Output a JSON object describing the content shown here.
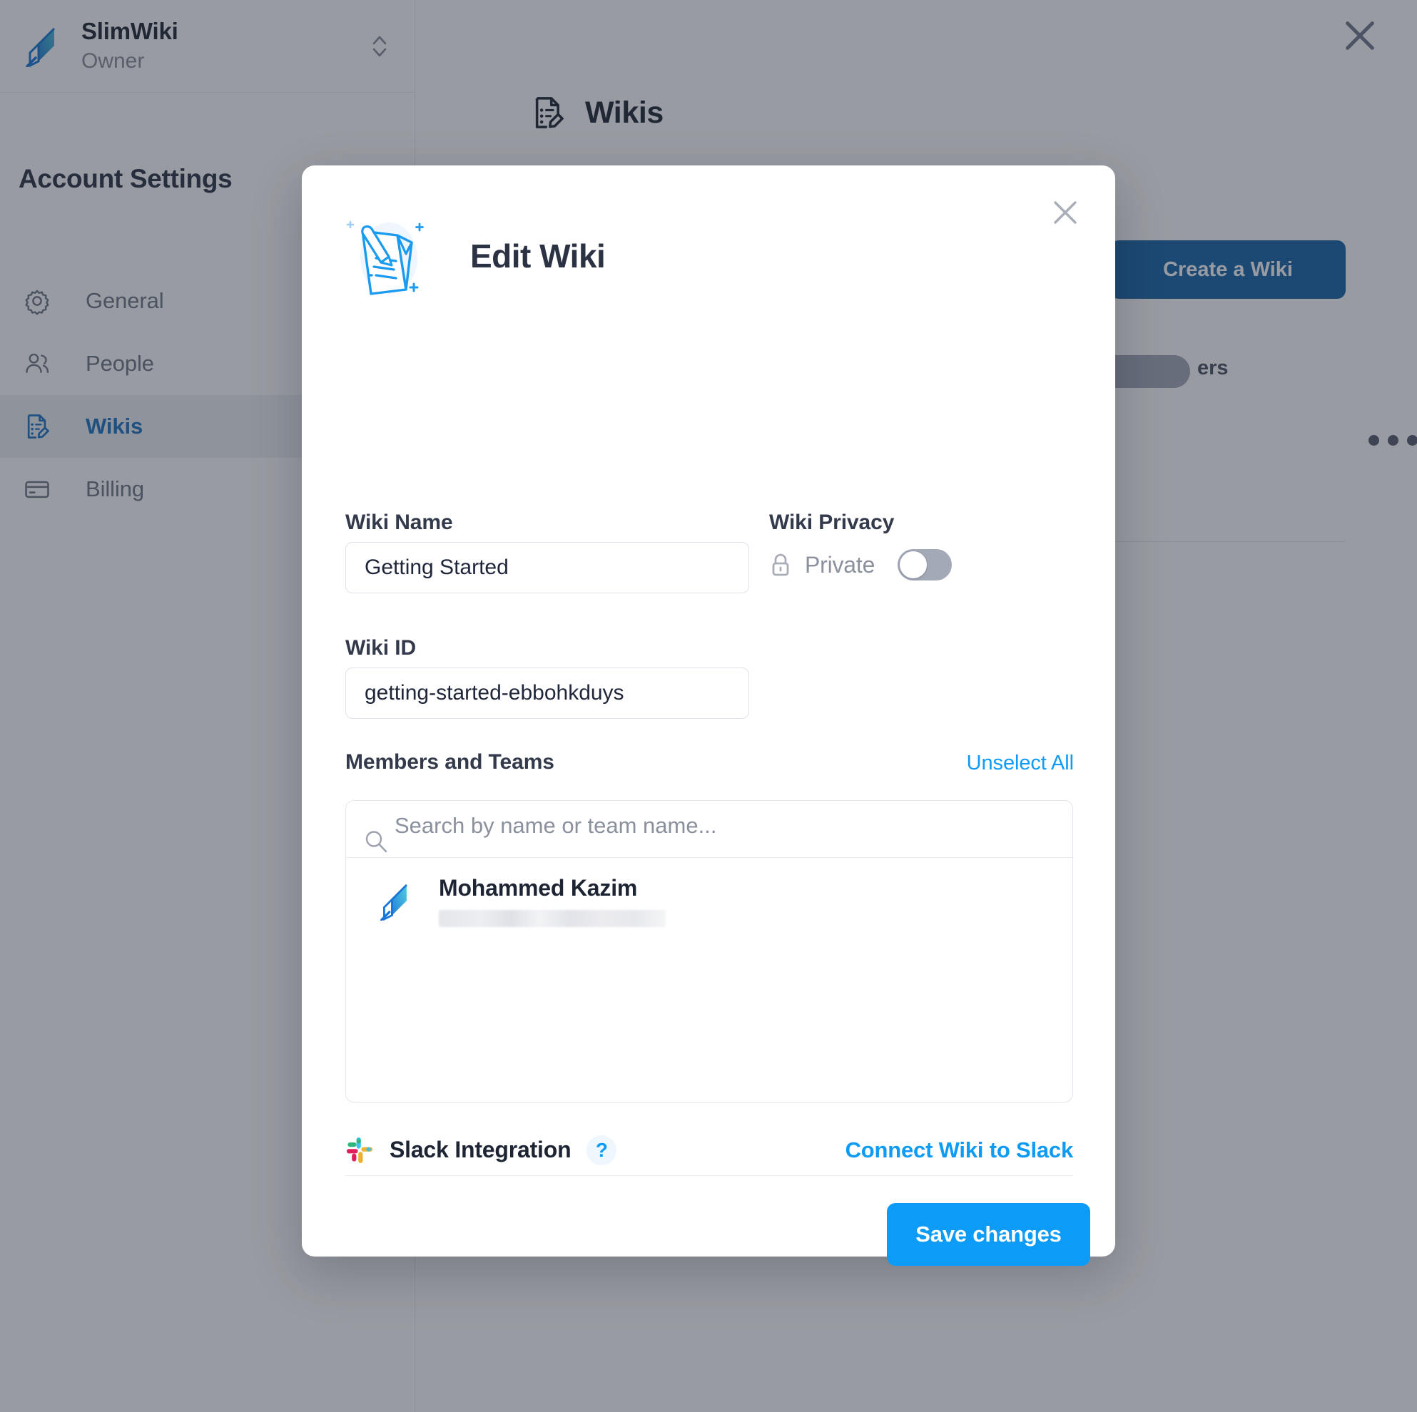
{
  "sidebar": {
    "workspace": {
      "name": "SlimWiki",
      "role": "Owner",
      "logo_icon": "feather-logo-icon",
      "switcher_icon": "chevron-up-down-icon"
    },
    "section_title": "Account Settings",
    "items": [
      {
        "label": "General",
        "icon": "gear-icon",
        "active": false
      },
      {
        "label": "People",
        "icon": "people-icon",
        "active": false
      },
      {
        "label": "Wikis",
        "icon": "document-edit-icon",
        "active": true
      },
      {
        "label": "Billing",
        "icon": "credit-card-icon",
        "active": false
      }
    ]
  },
  "background_page": {
    "title": "Wikis",
    "title_icon": "document-edit-icon",
    "create_button_label": "Create a Wiki",
    "card_meta_text": "ers",
    "card_menu_icon": "ellipsis-horizontal-icon"
  },
  "overlay": {
    "close_icon": "close-icon"
  },
  "modal": {
    "title": "Edit Wiki",
    "header_icon": "edit-wiki-illustration-icon",
    "close_icon": "close-icon",
    "wiki_name": {
      "label": "Wiki Name",
      "value": "Getting Started",
      "placeholder": "Wiki Name"
    },
    "wiki_id": {
      "label": "Wiki ID",
      "value": "getting-started-ebbohkduys",
      "placeholder": "Wiki ID"
    },
    "privacy": {
      "label": "Wiki Privacy",
      "state_label": "Private",
      "lock_icon": "lock-icon",
      "toggle_on": false
    },
    "members": {
      "label": "Members and Teams",
      "unselect_all_label": "Unselect All",
      "search_placeholder": "Search by name or team name...",
      "search_value": "",
      "search_icon": "search-icon",
      "list": [
        {
          "name": "Mohammed Kazim",
          "email": "",
          "email_redacted": true,
          "avatar_icon": "feather-logo-icon"
        }
      ]
    },
    "slack": {
      "label": "Slack Integration",
      "icon": "slack-icon",
      "help_label": "?",
      "connect_label": "Connect Wiki to Slack"
    },
    "save_label": "Save changes"
  },
  "colors": {
    "brand_blue": "#0d9bf5",
    "dark_blue": "#1565a8",
    "active_nav": "#1a74c4",
    "text_dark": "#1d2433",
    "text_muted": "#8b909d",
    "slack_green": "#2EB67D",
    "slack_blue": "#36C5F0",
    "slack_red": "#E01E5A",
    "slack_yellow": "#ECB22E"
  }
}
